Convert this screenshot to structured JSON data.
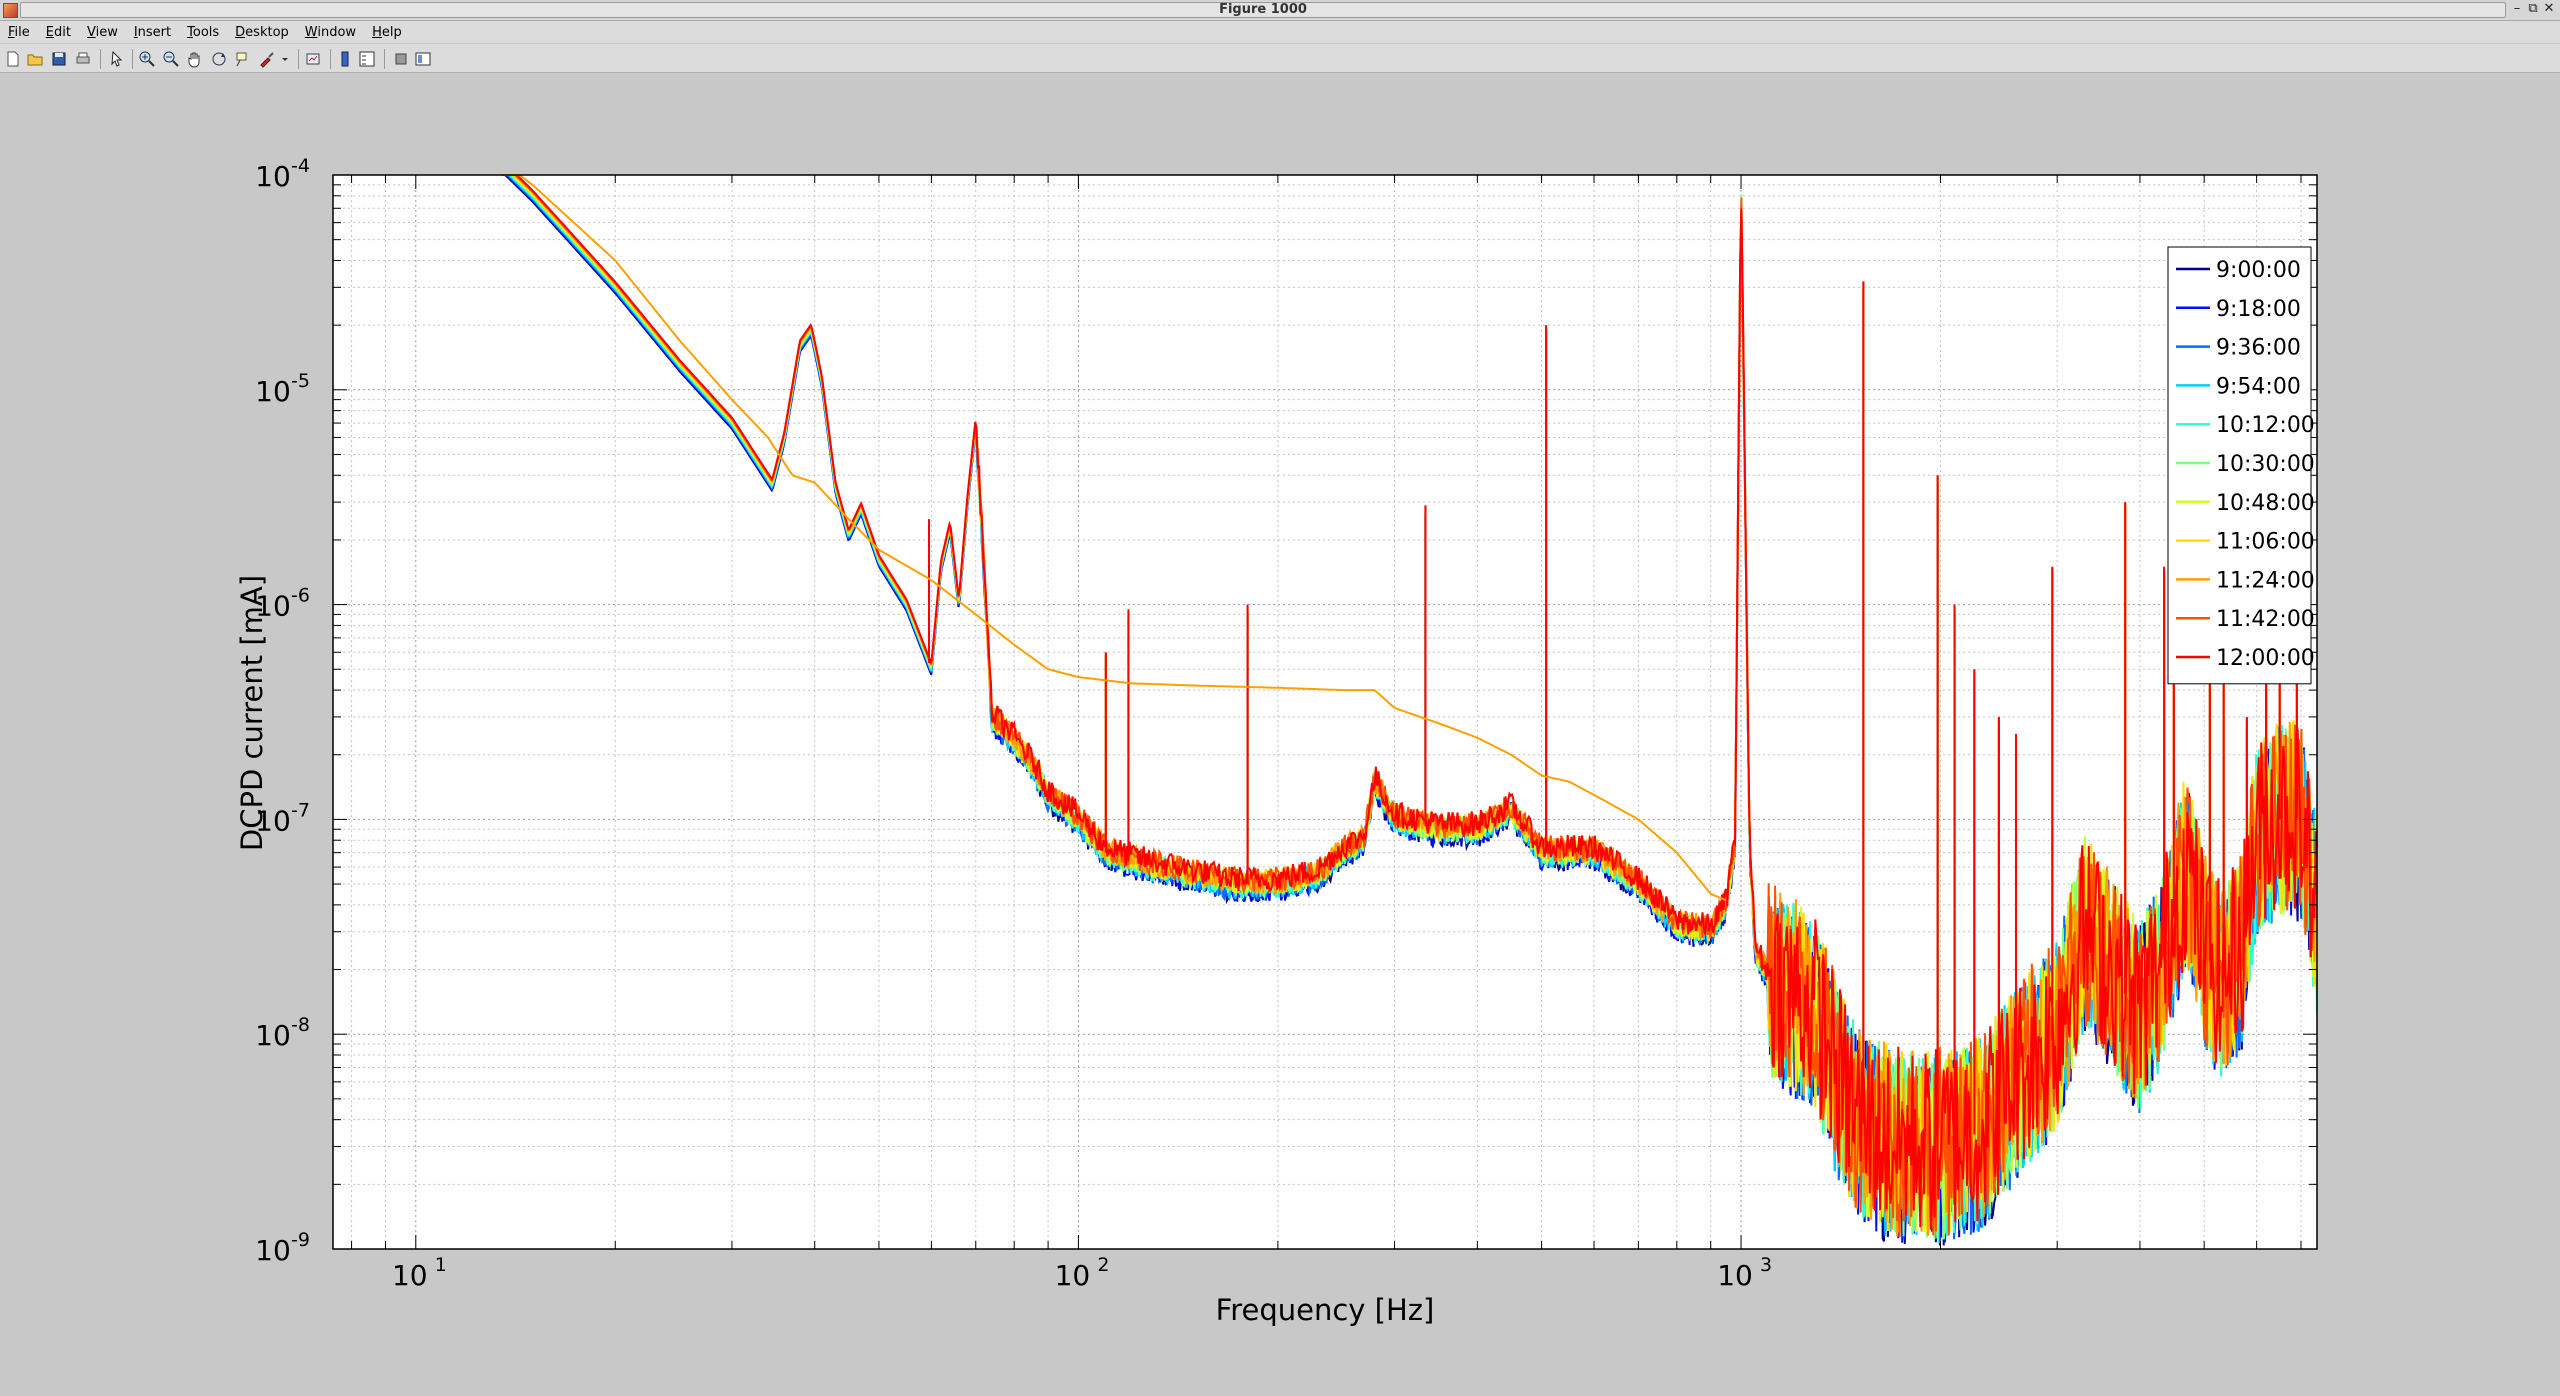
{
  "window": {
    "title": "Figure 1000",
    "controls": [
      "minimize",
      "restore",
      "close"
    ]
  },
  "menu": [
    {
      "label": "File",
      "key": "F",
      "rest": "ile"
    },
    {
      "label": "Edit",
      "key": "E",
      "rest": "dit"
    },
    {
      "label": "View",
      "key": "V",
      "rest": "iew"
    },
    {
      "label": "Insert",
      "key": "I",
      "rest": "nsert"
    },
    {
      "label": "Tools",
      "key": "T",
      "rest": "ools"
    },
    {
      "label": "Desktop",
      "key": "D",
      "rest": "esktop"
    },
    {
      "label": "Window",
      "key": "W",
      "rest": "indow"
    },
    {
      "label": "Help",
      "key": "H",
      "rest": "elp"
    }
  ],
  "toolbar": [
    "new-figure-icon",
    "open-file-icon",
    "save-icon",
    "print-icon",
    "edit-plot-arrow-icon",
    "zoom-in-icon",
    "zoom-out-icon",
    "pan-hand-icon",
    "rotate-3d-icon",
    "data-cursor-icon",
    "brush-icon",
    "link-plot-icon",
    "colorbar-icon",
    "legend-icon",
    "hide-plot-tools-icon",
    "show-plot-tools-icon"
  ],
  "chart_data": {
    "type": "line",
    "title": "",
    "xlabel": "Frequency [Hz]",
    "ylabel": "DCPD current [mA]",
    "xscale": "log",
    "yscale": "log",
    "xlim": [
      7.5,
      7400
    ],
    "ylim": [
      1e-09,
      0.0001
    ],
    "x_ticks": [
      {
        "value": 10,
        "base": "10",
        "exp": "1"
      },
      {
        "value": 100,
        "base": "10",
        "exp": "2"
      },
      {
        "value": 1000,
        "base": "10",
        "exp": "3"
      }
    ],
    "y_ticks": [
      {
        "value": 1e-09,
        "base": "10",
        "exp": "-9"
      },
      {
        "value": 1e-08,
        "base": "10",
        "exp": "-8"
      },
      {
        "value": 1e-07,
        "base": "10",
        "exp": "-7"
      },
      {
        "value": 1e-06,
        "base": "10",
        "exp": "-6"
      },
      {
        "value": 1e-05,
        "base": "10",
        "exp": "-5"
      },
      {
        "value": 0.0001,
        "base": "10",
        "exp": "-4"
      }
    ],
    "grid": true,
    "legend_position": "top-right",
    "series": [
      {
        "name": "9:00:00",
        "color": "#00008f"
      },
      {
        "name": "9:18:00",
        "color": "#0010ff"
      },
      {
        "name": "9:36:00",
        "color": "#0070ff"
      },
      {
        "name": "9:54:00",
        "color": "#00cfff"
      },
      {
        "name": "10:12:00",
        "color": "#30ffcf"
      },
      {
        "name": "10:30:00",
        "color": "#80ff80"
      },
      {
        "name": "10:48:00",
        "color": "#cfff30"
      },
      {
        "name": "11:06:00",
        "color": "#ffdf00"
      },
      {
        "name": "11:24:00",
        "color": "#ffa000"
      },
      {
        "name": "11:42:00",
        "color": "#ff5000"
      },
      {
        "name": "12:00:00",
        "color": "#ff0000"
      }
    ],
    "base_spectrum": [
      [
        13.5,
        0.00011
      ],
      [
        15,
        8e-05
      ],
      [
        20,
        3e-05
      ],
      [
        25,
        1.3e-05
      ],
      [
        30,
        7e-06
      ],
      [
        34.5,
        3.6e-06
      ],
      [
        36,
        6e-06
      ],
      [
        38,
        1.6e-05
      ],
      [
        39.5,
        1.9e-05
      ],
      [
        41,
        1.1e-05
      ],
      [
        43,
        3.5e-06
      ],
      [
        45,
        2.1e-06
      ],
      [
        47,
        2.8e-06
      ],
      [
        50,
        1.6e-06
      ],
      [
        55,
        1e-06
      ],
      [
        60,
        5e-07
      ],
      [
        62,
        1.5e-06
      ],
      [
        64,
        2.3e-06
      ],
      [
        66,
        1e-06
      ],
      [
        68,
        3e-06
      ],
      [
        70,
        7e-06
      ],
      [
        72,
        1.5e-06
      ],
      [
        74,
        3e-07
      ],
      [
        80,
        2.3e-07
      ],
      [
        85,
        1.8e-07
      ],
      [
        90,
        1.3e-07
      ],
      [
        100,
        1e-07
      ],
      [
        110,
        7e-08
      ],
      [
        130,
        6e-08
      ],
      [
        150,
        5.5e-08
      ],
      [
        170,
        5e-08
      ],
      [
        200,
        5e-08
      ],
      [
        230,
        5.5e-08
      ],
      [
        250,
        7e-08
      ],
      [
        270,
        8e-08
      ],
      [
        280,
        1.5e-07
      ],
      [
        300,
        1e-07
      ],
      [
        350,
        9e-08
      ],
      [
        400,
        9e-08
      ],
      [
        450,
        1.1e-07
      ],
      [
        500,
        7e-08
      ],
      [
        550,
        7e-08
      ],
      [
        600,
        7e-08
      ],
      [
        700,
        5e-08
      ],
      [
        800,
        3.2e-08
      ],
      [
        900,
        3e-08
      ],
      [
        950,
        4e-08
      ],
      [
        980,
        8e-08
      ],
      [
        1000,
        0.0001
      ],
      [
        1030,
        8e-08
      ],
      [
        1050,
        2.5e-08
      ],
      [
        1100,
        1.8e-08
      ],
      [
        1200,
        1.5e-08
      ],
      [
        1300,
        1.2e-08
      ],
      [
        1400,
        6e-09
      ],
      [
        1500,
        4e-09
      ],
      [
        1700,
        3e-09
      ],
      [
        2000,
        3e-09
      ],
      [
        2300,
        3.5e-09
      ],
      [
        2600,
        6e-09
      ],
      [
        3000,
        1e-08
      ],
      [
        3300,
        3e-08
      ],
      [
        3600,
        2e-08
      ],
      [
        4000,
        1.2e-08
      ],
      [
        4300,
        2e-08
      ],
      [
        4700,
        6e-08
      ],
      [
        5000,
        2.5e-08
      ],
      [
        5300,
        1.7e-08
      ],
      [
        5700,
        2.5e-08
      ],
      [
        6000,
        8e-08
      ],
      [
        6500,
        1e-07
      ],
      [
        7000,
        1e-07
      ],
      [
        7400,
        3.5e-08
      ]
    ],
    "reference_spectrum": [
      [
        13.5,
        0.000115
      ],
      [
        15,
        9e-05
      ],
      [
        20,
        4e-05
      ],
      [
        25,
        1.7e-05
      ],
      [
        30,
        9e-06
      ],
      [
        34,
        6e-06
      ],
      [
        37,
        4e-06
      ],
      [
        40,
        3.7e-06
      ],
      [
        45,
        2.5e-06
      ],
      [
        50,
        1.8e-06
      ],
      [
        60,
        1.3e-06
      ],
      [
        70,
        9e-07
      ],
      [
        80,
        6.5e-07
      ],
      [
        90,
        5e-07
      ],
      [
        100,
        4.6e-07
      ],
      [
        120,
        4.3e-07
      ],
      [
        150,
        4.2e-07
      ],
      [
        200,
        4.1e-07
      ],
      [
        250,
        4e-07
      ],
      [
        280,
        4e-07
      ],
      [
        300,
        3.3e-07
      ],
      [
        350,
        2.8e-07
      ],
      [
        400,
        2.4e-07
      ],
      [
        450,
        2e-07
      ],
      [
        500,
        1.6e-07
      ],
      [
        550,
        1.5e-07
      ],
      [
        600,
        1.3e-07
      ],
      [
        700,
        1e-07
      ],
      [
        800,
        7e-08
      ],
      [
        900,
        4.5e-08
      ],
      [
        950,
        4.2e-08
      ]
    ],
    "peaks": [
      {
        "f": 59.5,
        "value": 2.5e-06
      },
      {
        "f": 110,
        "value": 6e-07
      },
      {
        "f": 119,
        "value": 9.5e-07
      },
      {
        "f": 180,
        "value": 1e-06
      },
      {
        "f": 334,
        "value": 2.9e-06
      },
      {
        "f": 508,
        "value": 2e-05
      },
      {
        "f": 1530,
        "value": 3.2e-05
      },
      {
        "f": 1980,
        "value": 4e-06
      },
      {
        "f": 2100,
        "value": 1e-06
      },
      {
        "f": 2250,
        "value": 5e-07
      },
      {
        "f": 2450,
        "value": 3e-07
      },
      {
        "f": 2600,
        "value": 2.5e-07
      },
      {
        "f": 2950,
        "value": 1.5e-06
      },
      {
        "f": 3800,
        "value": 3e-06
      },
      {
        "f": 4350,
        "value": 1.5e-06
      },
      {
        "f": 4500,
        "value": 9e-07
      },
      {
        "f": 5100,
        "value": 2.5e-06
      },
      {
        "f": 5350,
        "value": 6e-07
      },
      {
        "f": 5800,
        "value": 3e-07
      },
      {
        "f": 6200,
        "value": 9e-07
      },
      {
        "f": 6500,
        "value": 1.5e-06
      },
      {
        "f": 6900,
        "value": 9e-07
      }
    ]
  }
}
